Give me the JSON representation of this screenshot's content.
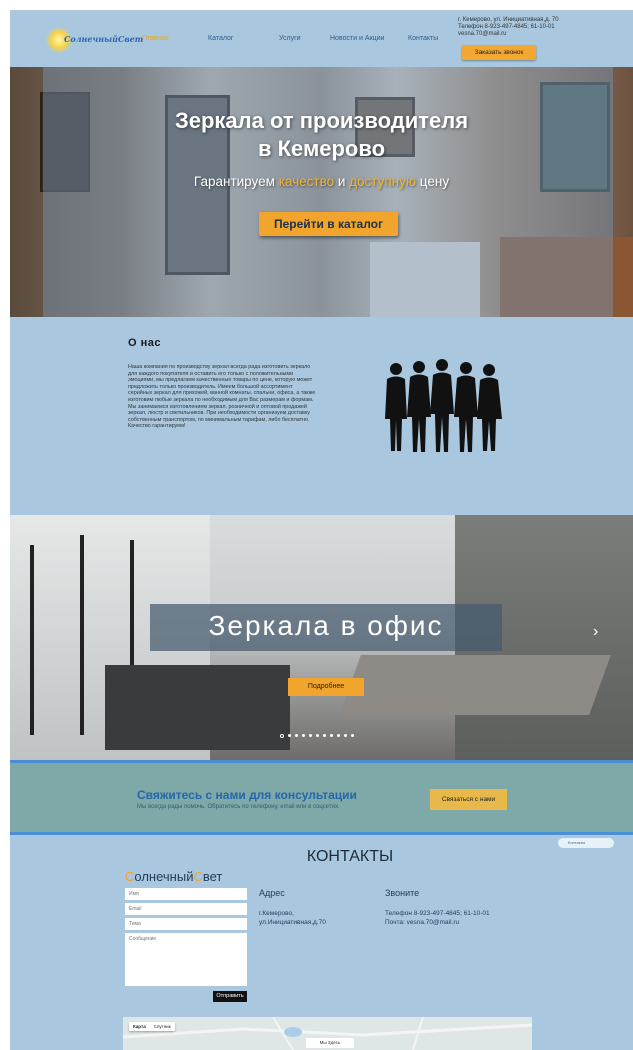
{
  "header": {
    "logo_text": "СолнечныйСвет",
    "nav": [
      "Главная",
      "Каталог",
      "Услуги",
      "Новости и Акции",
      "Контакты"
    ],
    "contacts": [
      "г. Кемерово, ул. Инициативная,д. 70",
      "Телефон 8-923-497-4845; 61-10-01",
      "vesna.70@mail.ru"
    ],
    "callback_label": "Заказать звонок"
  },
  "hero": {
    "title_line1": "Зеркала от производителя",
    "title_line2": "в Кемерово",
    "subtitle_start": "Гарантируем ",
    "subtitle_hl1": "качество",
    "subtitle_mid": " и ",
    "subtitle_hl2": "доступную",
    "subtitle_end": " цену",
    "button_label": "Перейти в каталог"
  },
  "about": {
    "title": "О нас",
    "text": "Наша компания по производству зеркал всегда рада изготовить зеркало для каждого покупателя и оставить его только с положительными эмоциями, мы предлагаем качественные товары по цене, которую может предложить только производитель. Имеем большой ассортимент серийных зеркал для прихожей, ванной комнаты, спальни, офиса, а также изготовим любые зеркала по необходимым для Вас размерам и формам. Мы занимаемся изготовлением зеркал, розничной и оптовой продажей зеркал, люстр и светильников. При необходимости организуем доставку собственным транспортом, по минимальным тарифам, либо бесплатно. Качество гарантируем!"
  },
  "office": {
    "title": "Зеркала в офис",
    "button_label": "Подробнее",
    "arrow_glyph": "›",
    "slides_total": 11,
    "active_slide": 0
  },
  "consult": {
    "title": "Свяжитесь с нами для консультации",
    "subtitle": "Мы всегда рады помочь. Обратитесь по телефону, email или в соцсетях.",
    "button_label": "Связаться с нами"
  },
  "contacts": {
    "title": "КОНТАКТЫ",
    "brand_c1": "С",
    "brand_p1": "олнечный",
    "brand_c2": "С",
    "brand_p2": "вет",
    "form": {
      "name_placeholder": "Имя",
      "email_placeholder": "Email",
      "subject_placeholder": "Тема",
      "message_placeholder": "Сообщение",
      "send_label": "Отправить"
    },
    "address_head": "Адрес",
    "address_line1": "г.Кемерово,",
    "address_line2": "ул.Инициативная,д.70",
    "call_head": "Звоните",
    "phone_line": "Телефон  8-923-497-4845; 61-10-01",
    "mail_line": "Почта:    vesna.70@mail.ru",
    "map_tabs": [
      "Карта",
      "Спутник"
    ],
    "map_pill": "Мы Здесь",
    "widget_label": "Контакты"
  }
}
